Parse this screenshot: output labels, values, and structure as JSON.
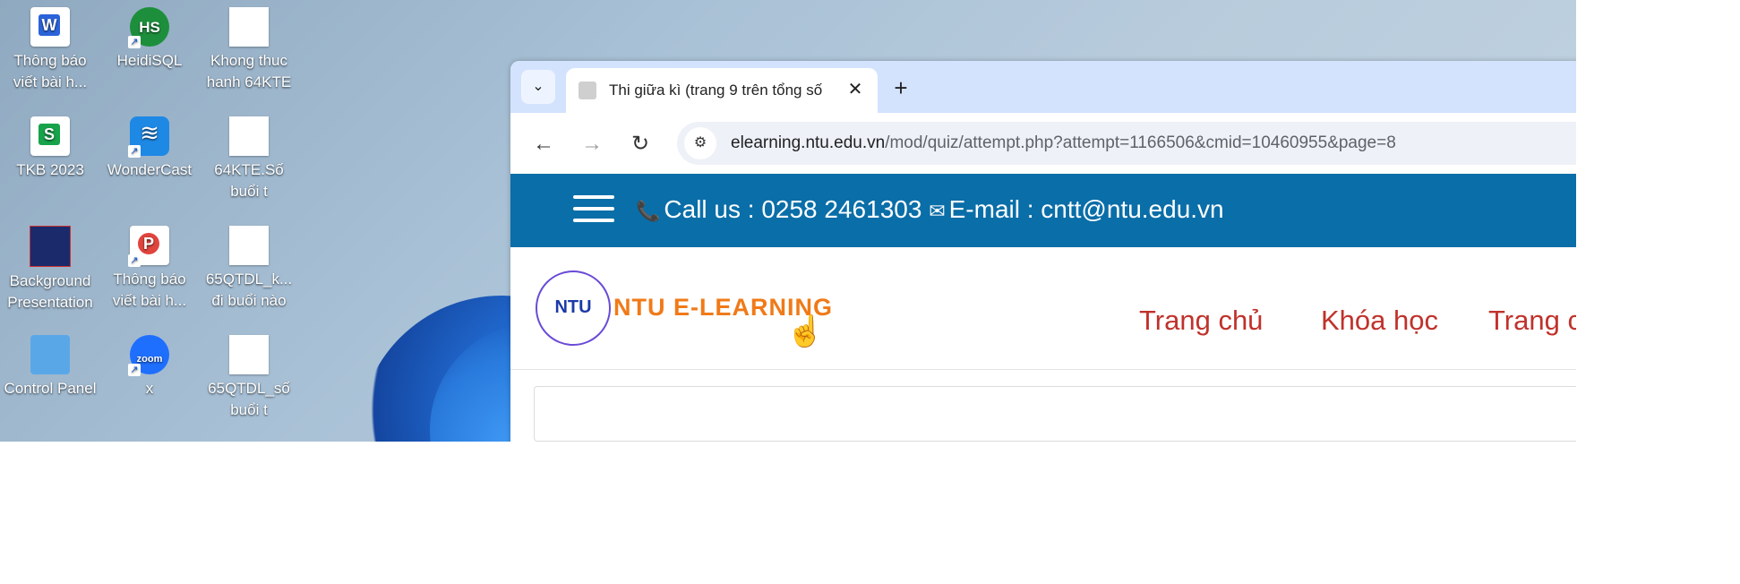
{
  "desktop": {
    "icons": [
      {
        "label": "Thông báo\nviết bài h...",
        "icon": "word-icon"
      },
      {
        "label": "HeidiSQL",
        "icon": "heidisql-icon"
      },
      {
        "label": "Khong thuc\nhanh 64KTE",
        "icon": "file-icon"
      },
      {
        "label": "TKB 2023",
        "icon": "spreadsheet-icon"
      },
      {
        "label": "WonderCast",
        "icon": "wondercast-icon"
      },
      {
        "label": "64KTE.Số\nbuổi t",
        "icon": "file-icon"
      },
      {
        "label": "Background\nPresentation",
        "icon": "presentation-thumbnail-icon"
      },
      {
        "label": "Thông báo\nviết bài h...",
        "icon": "pdf-icon"
      },
      {
        "label": "65QTDL_k...\nđi buổi nào",
        "icon": "file-icon"
      },
      {
        "label": "Control Panel",
        "icon": "control-panel-icon"
      },
      {
        "label": "x",
        "icon": "zoom-icon"
      },
      {
        "label": "65QTDL_số\nbuổi t",
        "icon": "file-icon"
      }
    ]
  },
  "browser": {
    "tab": {
      "title": "Thi giữa kì (trang 9 trên tổng số",
      "close": "✕"
    },
    "new_tab": "+",
    "tab_dropdown": "⌄",
    "nav": {
      "back": "←",
      "forward": "→",
      "reload": "↻"
    },
    "site_info_icon": "⚙",
    "url_host": "elearning.ntu.edu.vn",
    "url_rest": "/mod/quiz/attempt.php?attempt=1166506&cmid=10460955&page=8"
  },
  "site": {
    "phone_icon": "📞",
    "contact_phone": "Call us : 0258 2461303",
    "mail_icon": "✉",
    "contact_email": "E-mail : cntt@ntu.edu.vn",
    "logo_text": "NTU E-LEARNING",
    "hand_icon": "☝",
    "menu": [
      "Trang chủ",
      "Khóa học",
      "Trang cá"
    ]
  },
  "colors": {
    "topbar": "#0a6ea8",
    "menu_link": "#c0322b",
    "logo_orange": "#f07a18",
    "tabstrip": "#d3e3fd"
  }
}
